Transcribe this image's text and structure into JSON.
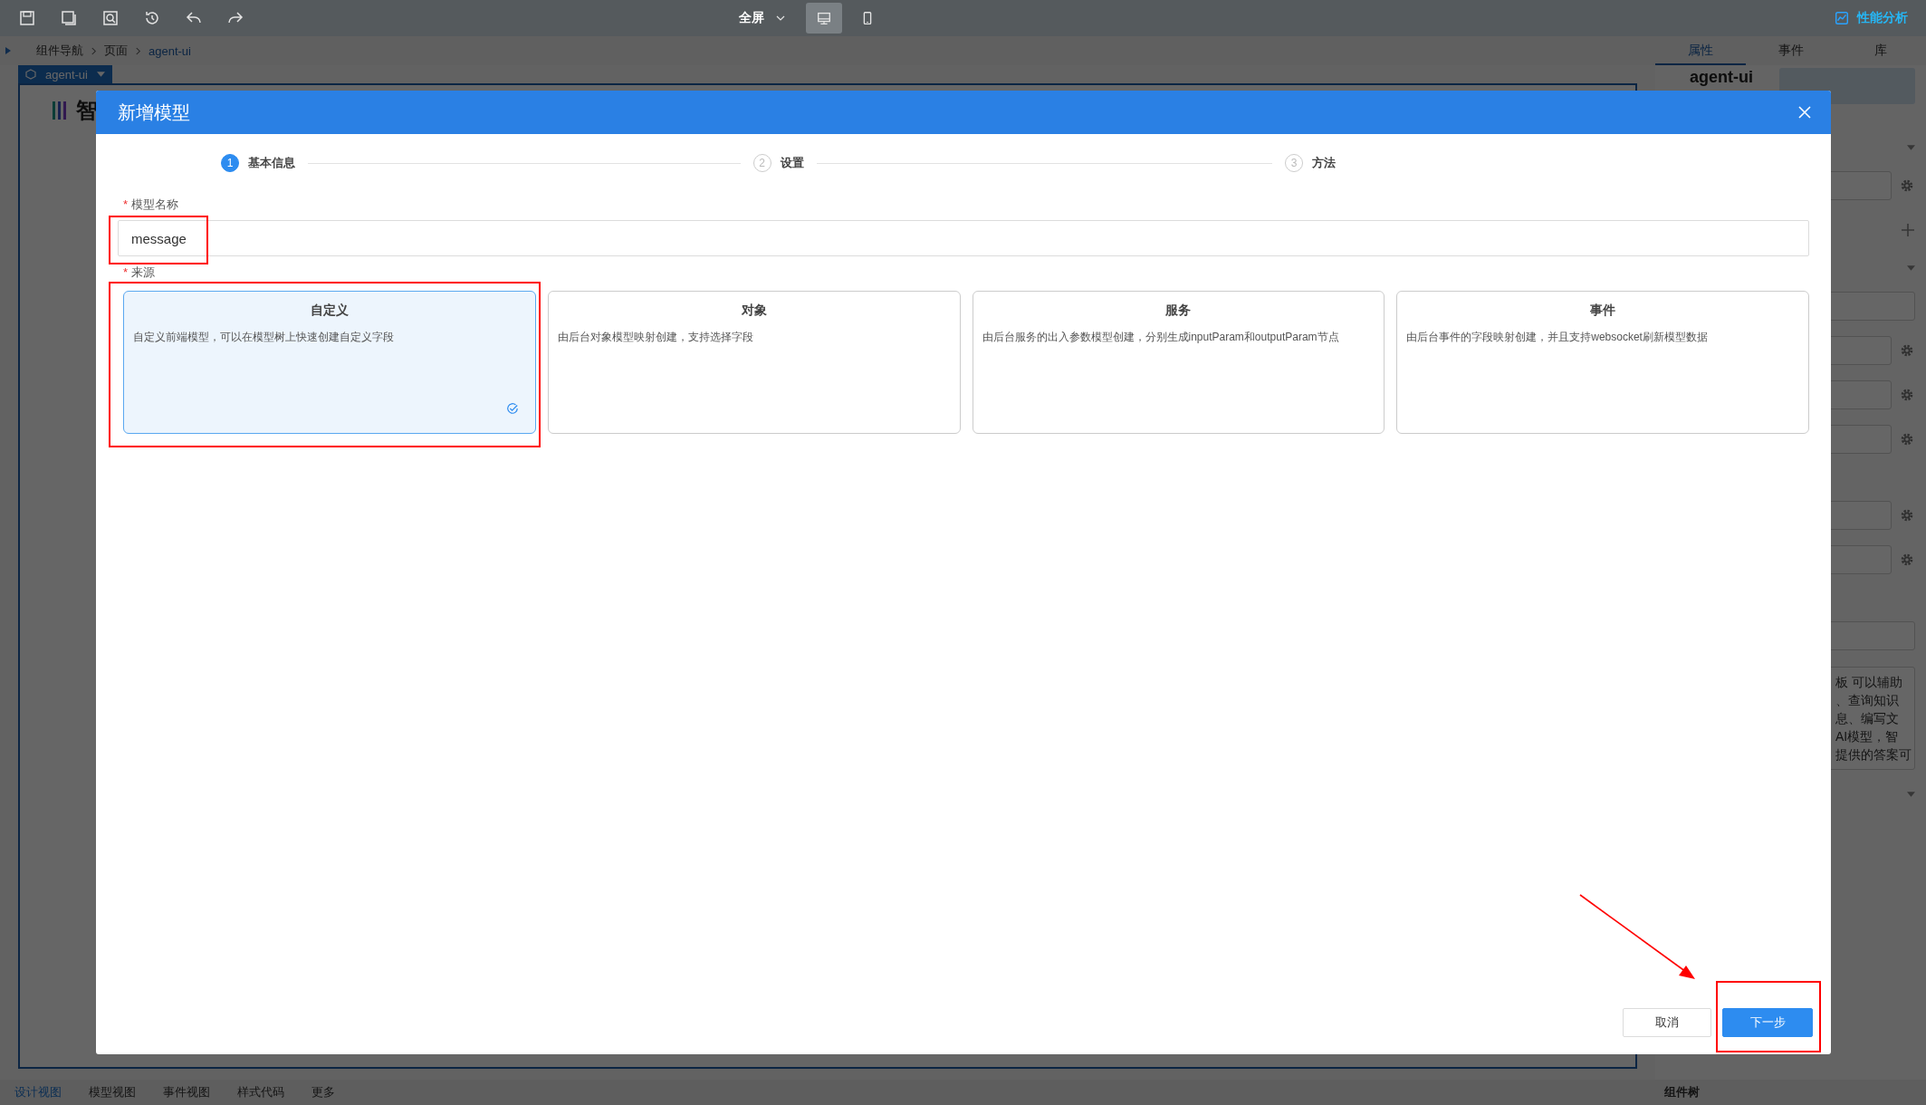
{
  "toolbar": {
    "view_select": {
      "value": "全屏"
    },
    "devices": [
      {
        "kind": "desktop",
        "selected": true
      },
      {
        "kind": "mobile",
        "selected": false
      }
    ],
    "perf_link": "性能分析"
  },
  "breadcrumb": [
    "组件导航",
    "页面",
    "agent-ui"
  ],
  "canvas": {
    "tab": "agent-ui",
    "heading": "智"
  },
  "right_panel": {
    "tabs": [
      {
        "label": "属性",
        "selected": true
      },
      {
        "label": "事件",
        "selected": false
      },
      {
        "label": "库",
        "selected": false
      }
    ],
    "heading": "agent-ui",
    "textarea_lines": [
      "板 可以辅助",
      "、查询知识",
      "息、编写文",
      "AI模型，智",
      "提供的答案可"
    ],
    "footer": "组件树"
  },
  "bottom_tabs": [
    {
      "label": "设计视图",
      "selected": true
    },
    {
      "label": "模型视图",
      "selected": false
    },
    {
      "label": "事件视图",
      "selected": false
    },
    {
      "label": "样式代码",
      "selected": false
    },
    {
      "label": "更多",
      "selected": false
    }
  ],
  "dialog": {
    "title": "新增模型",
    "steps": [
      {
        "number": "1",
        "label": "基本信息",
        "active": true
      },
      {
        "number": "2",
        "label": "设置",
        "active": false
      },
      {
        "number": "3",
        "label": "方法",
        "active": false
      }
    ],
    "name_field": {
      "required_mark": "*",
      "label": "模型名称",
      "value": "message"
    },
    "source_field": {
      "required_mark": "*",
      "label": "来源"
    },
    "source_options": [
      {
        "title": "自定义",
        "description": "自定义前端模型，可以在模型树上快速创建自定义字段",
        "selected": true
      },
      {
        "title": "对象",
        "description": "由后台对象模型映射创建，支持选择字段",
        "selected": false
      },
      {
        "title": "服务",
        "description": "由后台服务的出入参数模型创建，分别生成inputParam和outputParam节点",
        "selected": false
      },
      {
        "title": "事件",
        "description": "由后台事件的字段映射创建，并且支持websocket刷新模型数据",
        "selected": false
      }
    ],
    "buttons": {
      "cancel": "取消",
      "next": "下一步"
    }
  }
}
